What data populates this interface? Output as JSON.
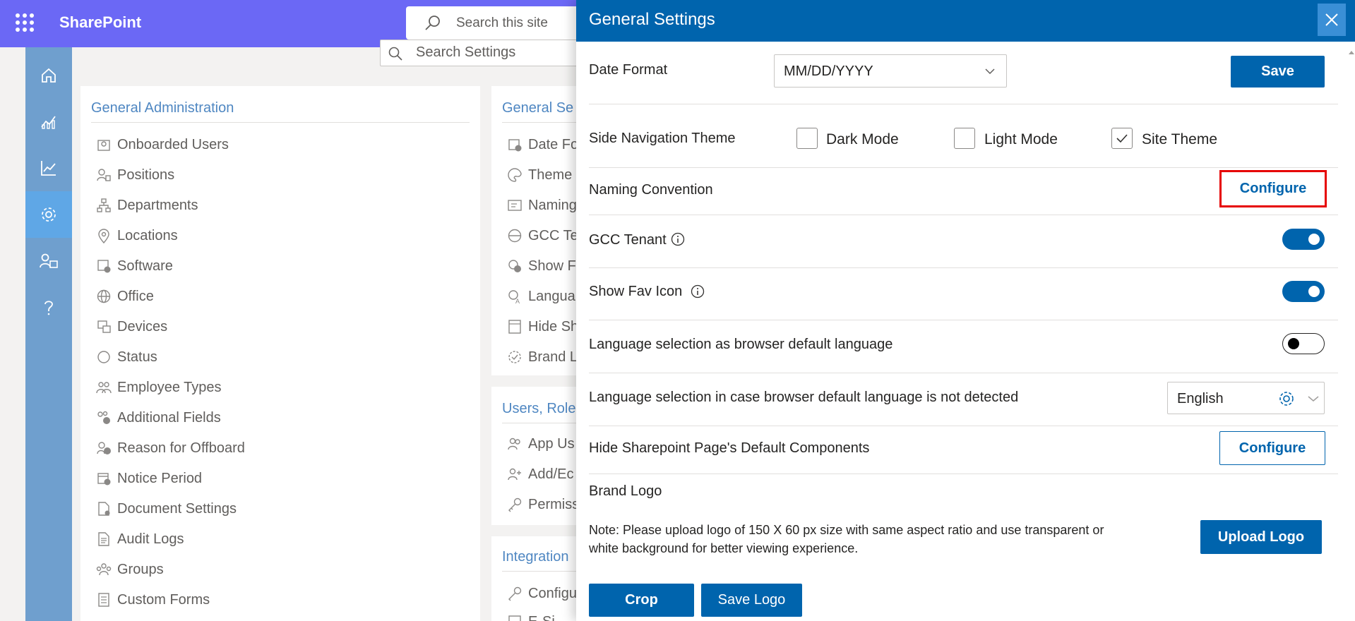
{
  "app": {
    "title": "SharePoint",
    "search_placeholder": "Search this site"
  },
  "rail": {
    "items": [
      {
        "name": "home-icon"
      },
      {
        "name": "analytics-icon"
      },
      {
        "name": "trend-icon"
      },
      {
        "name": "settings-icon",
        "active": true
      },
      {
        "name": "user-management-icon"
      },
      {
        "name": "help-icon"
      }
    ],
    "active_color": "#5fa7e6"
  },
  "background": {
    "search_placeholder": "Search Settings",
    "general_admin": {
      "title": "General Administration",
      "items": [
        "Onboarded Users",
        "Positions",
        "Departments",
        "Locations",
        "Software",
        "Office",
        "Devices",
        "Status",
        "Employee Types",
        "Additional Fields",
        "Reason for Offboard",
        "Notice Period",
        "Document Settings",
        "Audit Logs",
        "Groups",
        "Custom Forms"
      ]
    },
    "general_settings": {
      "title": "General Se",
      "items": [
        "Date Fo",
        "Theme",
        "Naming",
        "GCC Te",
        "Show F",
        "Langua",
        "Hide Sh",
        "Brand L"
      ]
    },
    "users_roles": {
      "title": "Users, Role",
      "items": [
        "App Us",
        "Add/Ec",
        "Permiss"
      ]
    },
    "integrations": {
      "title": "Integration",
      "items": [
        "Configu",
        "E-Si"
      ]
    }
  },
  "panel": {
    "title": "General Settings",
    "date_format": {
      "label": "Date Format",
      "value": "MM/DD/YYYY",
      "save_label": "Save"
    },
    "side_nav_theme": {
      "label": "Side Navigation Theme",
      "options": [
        {
          "label": "Dark Mode",
          "checked": false
        },
        {
          "label": "Light Mode",
          "checked": false
        },
        {
          "label": "Site Theme",
          "checked": true
        }
      ]
    },
    "naming_convention": {
      "label": "Naming Convention",
      "button": "Configure"
    },
    "gcc_tenant": {
      "label": "GCC Tenant",
      "on": true
    },
    "show_fav_icon": {
      "label": "Show Fav Icon",
      "on": true
    },
    "lang_browser_default": {
      "label": "Language selection as browser default language",
      "on": false
    },
    "lang_fallback": {
      "label": "Language selection in case browser default language is not detected",
      "value": "English"
    },
    "hide_components": {
      "label": "Hide Sharepoint Page's Default Components",
      "button": "Configure"
    },
    "brand_logo": {
      "label": "Brand Logo",
      "note_line1": "Note: Please upload logo of 150 X 60 px size with same aspect ratio and use transparent or",
      "note_line2": "white background for better viewing experience.",
      "upload_label": "Upload Logo",
      "crop_label": "Crop",
      "save_logo_label": "Save Logo"
    }
  },
  "colors": {
    "topbar": "#6b68f5",
    "primary": "#0064ad",
    "highlight": "#e60000"
  }
}
